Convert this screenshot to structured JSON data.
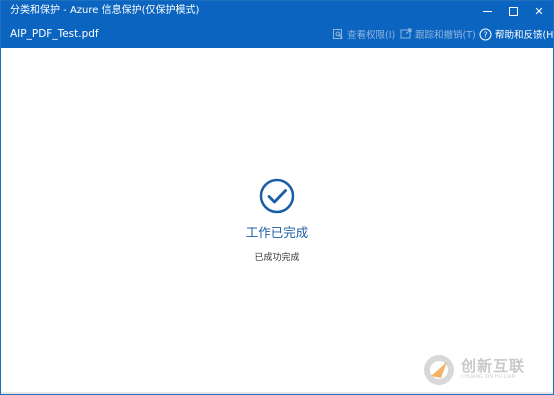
{
  "window": {
    "title": "分类和保护 - Azure 信息保护(仅保护模式)",
    "minimize_icon": "minimize-icon",
    "maximize_icon": "maximize-icon",
    "close_label": "✕"
  },
  "header": {
    "filename": "AIP_PDF_Test.pdf",
    "actions": [
      {
        "label": "查看权限(I)",
        "icon": "view-permissions-icon",
        "enabled": false
      },
      {
        "label": "跟踪和撤销(T)",
        "icon": "track-revoke-icon",
        "enabled": false
      },
      {
        "label": "帮助和反馈(H)",
        "icon": "help-icon",
        "enabled": true
      }
    ]
  },
  "main": {
    "status_icon": "check-circle-icon",
    "status_title": "工作已完成",
    "status_subtitle": "已成功完成"
  },
  "watermark": {
    "brand": "创新互联",
    "tagline": "CHUANG XIN HU LIAN"
  },
  "colors": {
    "accent": "#0a64c0",
    "status_blue": "#1a5ea8",
    "disabled_text": "#8fb6e0"
  }
}
